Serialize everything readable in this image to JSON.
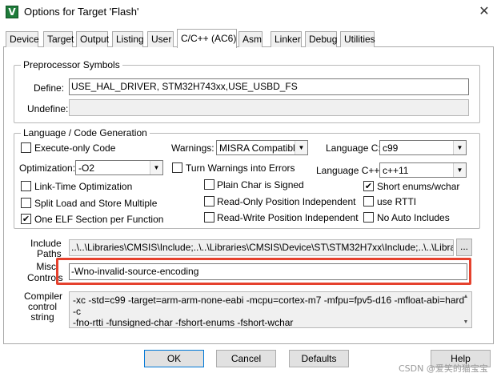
{
  "window": {
    "title": "Options for Target 'Flash'",
    "app_icon_glyph": "V",
    "app_icon_name": "keil-uvision-icon",
    "close_glyph": "✕"
  },
  "tabs": [
    {
      "label": "Device"
    },
    {
      "label": "Target"
    },
    {
      "label": "Output"
    },
    {
      "label": "Listing"
    },
    {
      "label": "User"
    },
    {
      "label": "C/C++ (AC6)",
      "active": true
    },
    {
      "label": "Asm"
    },
    {
      "label": "Linker"
    },
    {
      "label": "Debug"
    },
    {
      "label": "Utilities"
    }
  ],
  "preprocessor": {
    "legend": "Preprocessor Symbols",
    "define_label": "Define:",
    "define_value": "USE_HAL_DRIVER, STM32H743xx,USE_USBD_FS",
    "undefine_label": "Undefine:",
    "undefine_value": ""
  },
  "language": {
    "legend": "Language / Code Generation",
    "execute_only": {
      "label": "Execute-only Code",
      "checked": false
    },
    "warnings_label": "Warnings:",
    "warnings_value": "MISRA Compatible",
    "language_c_label": "Language C:",
    "language_c_value": "c99",
    "optimization_label": "Optimization:",
    "optimization_value": "-O2",
    "turn_warnings_errors": {
      "label": "Turn Warnings into Errors",
      "checked": false
    },
    "language_cpp_label": "Language C++:",
    "language_cpp_value": "c++11",
    "link_time": {
      "label": "Link-Time Optimization",
      "checked": false
    },
    "plain_char": {
      "label": "Plain Char is Signed",
      "checked": false
    },
    "short_enums": {
      "label": "Short enums/wchar",
      "checked": true
    },
    "split_load": {
      "label": "Split Load and Store Multiple",
      "checked": false
    },
    "ro_pi": {
      "label": "Read-Only Position Independent",
      "checked": false
    },
    "use_rtti": {
      "label": "use RTTI",
      "checked": false
    },
    "one_elf": {
      "label": "One ELF Section per Function",
      "checked": true
    },
    "rw_pi": {
      "label": "Read-Write Position Independent",
      "checked": false
    },
    "no_auto_includes": {
      "label": "No Auto Includes",
      "checked": false
    }
  },
  "paths": {
    "include_label_1": "Include",
    "include_label_2": "Paths",
    "include_value": "..\\..\\Libraries\\CMSIS\\Include;..\\..\\Libraries\\CMSIS\\Device\\ST\\STM32H7xx\\Include;..\\..\\Libraries\\S",
    "browse_label": "...",
    "misc_label_1": "Misc",
    "misc_label_2": "Controls",
    "misc_value": "-Wno-invalid-source-encoding",
    "compiler_label_1": "Compiler",
    "compiler_label_2": "control",
    "compiler_label_3": "string",
    "compiler_line_1": "-xc -std=c99 -target=arm-arm-none-eabi -mcpu=cortex-m7 -mfpu=fpv5-d16 -mfloat-abi=hard -c",
    "compiler_line_2": "-fno-rtti -funsigned-char -fshort-enums -fshort-wchar"
  },
  "buttons": {
    "ok": "OK",
    "cancel": "Cancel",
    "defaults": "Defaults",
    "help": "Help"
  },
  "watermark": "CSDN @爱笑的猫宝宝",
  "colors": {
    "highlight": "#e5412d",
    "focus_border": "#0078d7"
  },
  "check_glyph": "✔"
}
